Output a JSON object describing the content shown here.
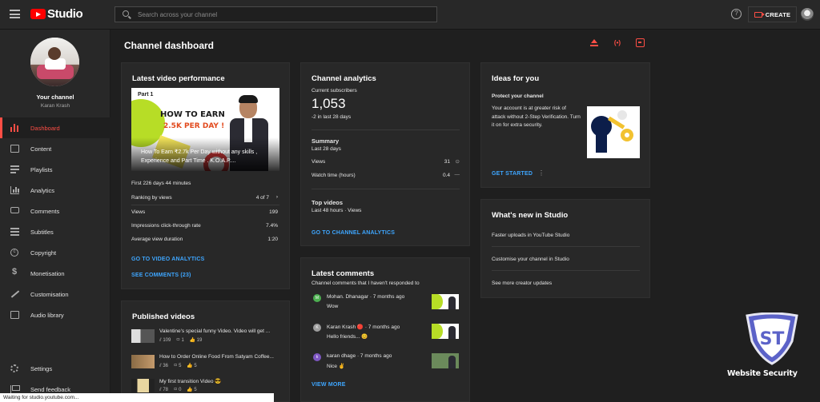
{
  "app": {
    "logo_text": "Studio"
  },
  "search": {
    "placeholder": "Search across your channel"
  },
  "topbar": {
    "create_label": "CREATE"
  },
  "channel": {
    "title": "Your channel",
    "name": "Karan Krash"
  },
  "nav": {
    "items": [
      {
        "label": "Dashboard",
        "icon": "dashboard-icon",
        "active": true
      },
      {
        "label": "Content",
        "icon": "content-icon"
      },
      {
        "label": "Playlists",
        "icon": "playlists-icon"
      },
      {
        "label": "Analytics",
        "icon": "analytics-icon"
      },
      {
        "label": "Comments",
        "icon": "comments-icon"
      },
      {
        "label": "Subtitles",
        "icon": "subtitles-icon"
      },
      {
        "label": "Copyright",
        "icon": "copyright-icon"
      },
      {
        "label": "Monetisation",
        "icon": "dollar-icon"
      },
      {
        "label": "Customisation",
        "icon": "wand-icon"
      },
      {
        "label": "Audio library",
        "icon": "audio-library-icon"
      }
    ],
    "bottom": [
      {
        "label": "Settings",
        "icon": "gear-icon"
      },
      {
        "label": "Send feedback",
        "icon": "feedback-icon"
      }
    ]
  },
  "status_bar": "Waiting for studio.youtube.com...",
  "page_title": "Channel dashboard",
  "latest_video": {
    "title": "Latest video performance",
    "thumb_part": "Part 1",
    "thumb_headline": "HOW TO EARN",
    "thumb_subline": "2.5K PER DAY !",
    "caption": "How To Earn ₹2.7k Per Day without any skills , Experience and Part Time . K.O.A.P....",
    "first_time": "First 226 days 44 minutes",
    "ranking_label": "Ranking by views",
    "ranking_value": "4 of 7",
    "rows": [
      {
        "label": "Views",
        "value": "199"
      },
      {
        "label": "Impressions click-through rate",
        "value": "7.4%"
      },
      {
        "label": "Average view duration",
        "value": "1:20"
      }
    ],
    "link_analytics": "GO TO VIDEO ANALYTICS",
    "link_comments": "SEE COMMENTS (23)"
  },
  "analytics": {
    "title": "Channel analytics",
    "subs_label": "Current subscribers",
    "subs_value": "1,053",
    "subs_change": "-2 in last 28 days",
    "summary_title": "Summary",
    "summary_period": "Last 28 days",
    "rows": [
      {
        "label": "Views",
        "value": "31"
      },
      {
        "label": "Watch time (hours)",
        "value": "0.4"
      }
    ],
    "top_title": "Top videos",
    "top_period": "Last 48 hours · Views",
    "link": "GO TO CHANNEL ANALYTICS"
  },
  "comments": {
    "title": "Latest comments",
    "subtitle": "Channel comments that I haven't responded to",
    "items": [
      {
        "author": "Mohan. Dhanagar · 7 months ago",
        "text": "Wow",
        "avatar": "M",
        "color": "#4caf50"
      },
      {
        "author": "Karan Krash 🔴 · 7 months ago",
        "text": "Hello friends... 😊",
        "avatar": "K",
        "color": "#9e9e9e"
      },
      {
        "author": "karan dhage · 7 months ago",
        "text": "Nice ✌",
        "avatar": "k",
        "color": "#7e57c2"
      }
    ],
    "link": "VIEW MORE"
  },
  "published": {
    "title": "Published videos",
    "items": [
      {
        "title": "Valentine's special funny Video. Video will get ...",
        "views": "109",
        "comments": "1",
        "likes": "19"
      },
      {
        "title": "How to Order Online Food From Satyam Coffee...",
        "views": "36",
        "comments": "5",
        "likes": "5"
      },
      {
        "title": "My first transition Video 😎",
        "views": "78",
        "comments": "0",
        "likes": "5"
      }
    ]
  },
  "ideas": {
    "title": "Ideas for you",
    "heading": "Protect your channel",
    "body": "Your account is at greater risk of attack without 2-Step Verification. Turn it on for extra security.",
    "cta": "GET STARTED"
  },
  "whats_new": {
    "title": "What's new in Studio",
    "items": [
      "Faster uploads in YouTube Studio",
      "Customise your channel in Studio",
      "See more creator updates"
    ]
  },
  "watermark": {
    "letters": "ST",
    "text": "Website Security"
  },
  "colors": {
    "accent": "#ff4e45",
    "link": "#3ea6ff",
    "background": "#1f1f1f",
    "card": "#282828"
  }
}
